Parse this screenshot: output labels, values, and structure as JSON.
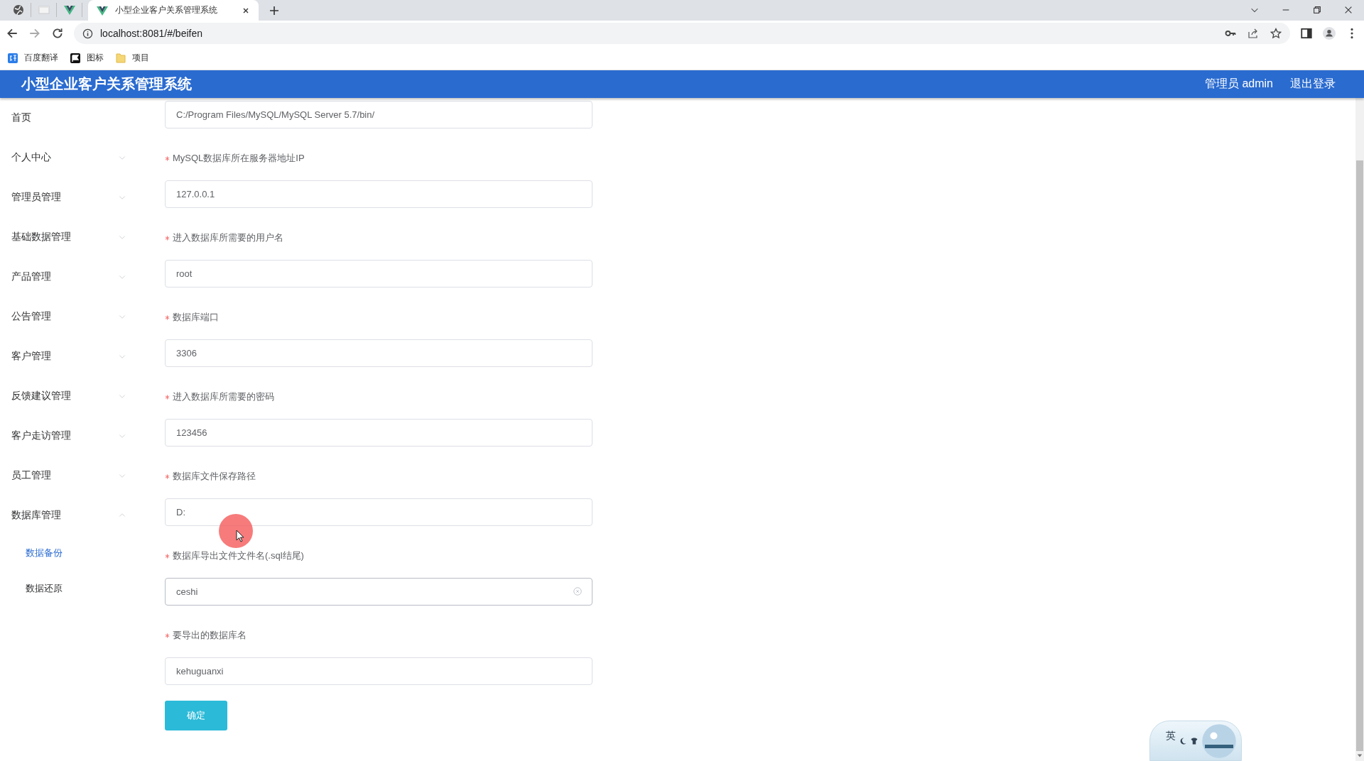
{
  "browser": {
    "tabs": [
      {
        "kind": "pinned",
        "selected": false
      },
      {
        "kind": "pinned",
        "selected": false
      },
      {
        "kind": "pinned",
        "selected": false
      },
      {
        "kind": "page",
        "title": "小型企业客户关系管理系统",
        "selected": true
      }
    ],
    "address": "localhost:8081/#/beifen",
    "bookmarks": [
      {
        "label": "百度翻译"
      },
      {
        "label": "图标"
      },
      {
        "label": "项目"
      }
    ]
  },
  "app": {
    "title": "小型企业客户关系管理系统",
    "user": "管理员 admin",
    "logout": "退出登录"
  },
  "sidebar": {
    "items": [
      {
        "label": "首页",
        "kind": "link",
        "selected": false
      },
      {
        "label": "个人中心",
        "kind": "submenu",
        "expanded": false
      },
      {
        "label": "管理员管理",
        "kind": "submenu",
        "expanded": false
      },
      {
        "label": "基础数据管理",
        "kind": "submenu",
        "expanded": false
      },
      {
        "label": "产品管理",
        "kind": "submenu",
        "expanded": false
      },
      {
        "label": "公告管理",
        "kind": "submenu",
        "expanded": false
      },
      {
        "label": "客户管理",
        "kind": "submenu",
        "expanded": false
      },
      {
        "label": "反馈建议管理",
        "kind": "submenu",
        "expanded": false
      },
      {
        "label": "客户走访管理",
        "kind": "submenu",
        "expanded": false
      },
      {
        "label": "员工管理",
        "kind": "submenu",
        "expanded": false
      },
      {
        "label": "数据库管理",
        "kind": "submenu",
        "expanded": true,
        "children": [
          {
            "label": "数据备份",
            "selected": true
          },
          {
            "label": "数据还原",
            "selected": false
          }
        ]
      }
    ]
  },
  "form": {
    "fields": [
      {
        "value": "C:/Program Files/MySQL/MySQL Server 5.7/bin/",
        "focused": false
      },
      {
        "label": "MySQL数据库所在服务器地址IP",
        "required": true,
        "value": "127.0.0.1",
        "focused": false
      },
      {
        "label": "进入数据库所需要的用户名",
        "required": true,
        "value": "root",
        "focused": false
      },
      {
        "label": "数据库端口",
        "required": true,
        "value": "3306",
        "focused": false
      },
      {
        "label": "进入数据库所需要的密码",
        "required": true,
        "value": "123456",
        "focused": false
      },
      {
        "label": "数据库文件保存路径",
        "required": true,
        "value": "D:",
        "focused": false
      },
      {
        "label": "数据库导出文件文件名(.sql结尾)",
        "required": true,
        "value": "ceshi",
        "focused": true
      },
      {
        "label": "要导出的数据库名",
        "required": true,
        "value": "kehuguanxi",
        "focused": false
      }
    ],
    "submit": "确定"
  },
  "ime": {
    "label": "英"
  }
}
